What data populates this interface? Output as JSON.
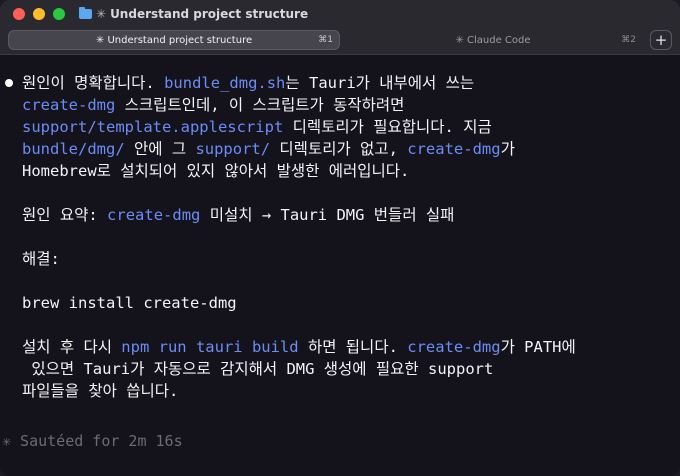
{
  "window": {
    "title": "Understand project structure",
    "title_prefix": "✳"
  },
  "tabs": [
    {
      "label": "✳ Understand project structure",
      "shortcut": "⌘1"
    },
    {
      "label": "✳ Claude Code",
      "shortcut": "⌘2"
    }
  ],
  "new_tab_label": "+",
  "message": {
    "l1a": "원인이 명확합니다. ",
    "l1b": "bundle_dmg.sh",
    "l1c": "는 Tauri가 내부에서 쓰는",
    "l2a": "create-dmg",
    "l2b": " 스크립트인데, 이 스크립트가 동작하려면",
    "l3a": "support/template.applescript",
    "l3b": " 디렉토리가 필요합니다. 지금",
    "l4a": "bundle/dmg/",
    "l4b": " 안에 그 ",
    "l4c": "support/",
    "l4d": " 디렉토리가 없고, ",
    "l4e": "create-dmg",
    "l4f": "가",
    "l5": "Homebrew로 설치되어 있지 않아서 발생한 에러입니다.",
    "summary_a": "원인 요약: ",
    "summary_b": "create-dmg",
    "summary_c": " 미설치 → Tauri DMG 번들러 실패",
    "solution": "해결:",
    "command": "brew install create-dmg",
    "after1a": "설치 후 다시 ",
    "after1b": "npm run tauri build",
    "after1c": " 하면 됩니다. ",
    "after1d": "create-dmg",
    "after1e": "가 PATH에",
    "after2": " 있으면 Tauri가 자동으로 감지해서 DMG 생성에 필요한 support",
    "after3": "파일들을 찾아 씁니다."
  },
  "status": "✳ Sautéed for 2m 16s",
  "colors": {
    "background": "#14131b",
    "code": "#6b8cf5",
    "text": "#f3f3f5",
    "muted": "#6c6b73"
  }
}
